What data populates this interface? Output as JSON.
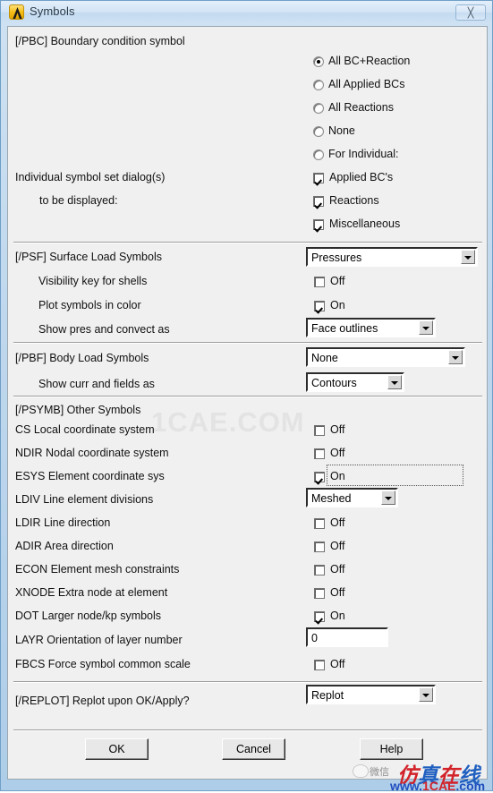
{
  "window": {
    "title": "Symbols",
    "icon": "ansys-logo-icon",
    "close_label": "╳"
  },
  "sections": {
    "pbc": {
      "heading": "[/PBC] Boundary condition symbol",
      "label_line1": "Individual symbol set dialog(s)",
      "label_line2": "to be displayed:",
      "radios": [
        {
          "label": "All BC+Reaction",
          "checked": true
        },
        {
          "label": "All Applied BCs",
          "checked": false
        },
        {
          "label": "All Reactions",
          "checked": false
        },
        {
          "label": "None",
          "checked": false
        },
        {
          "label": "For Individual:",
          "checked": false
        }
      ],
      "checkboxes": [
        {
          "label": "Applied BC's",
          "checked": true
        },
        {
          "label": "Reactions",
          "checked": true
        },
        {
          "label": "Miscellaneous",
          "checked": true
        }
      ]
    },
    "psf": {
      "heading": "[/PSF]  Surface Load Symbols",
      "heading_value": "Pressures",
      "rows": [
        {
          "label": "Visibility key for shells",
          "type": "checkbox",
          "state": "Off",
          "checked": false
        },
        {
          "label": "Plot symbols in color",
          "type": "checkbox",
          "state": "On",
          "checked": true
        },
        {
          "label": "Show pres and convect as",
          "type": "combo",
          "value": "Face outlines"
        }
      ]
    },
    "pbf": {
      "heading": "[/PBF]  Body Load Symbols",
      "heading_value": "None",
      "rows": [
        {
          "label": "Show curr and fields as",
          "type": "combo",
          "value": "Contours"
        }
      ]
    },
    "psymb": {
      "heading": "[/PSYMB] Other Symbols",
      "rows": [
        {
          "label": "CS   Local coordinate system",
          "type": "checkbox",
          "state": "Off",
          "checked": false,
          "focused": false
        },
        {
          "label": "NDIR Nodal coordinate system",
          "type": "checkbox",
          "state": "Off",
          "checked": false,
          "focused": false
        },
        {
          "label": "ESYS Element coordinate sys",
          "type": "checkbox",
          "state": "On",
          "checked": true,
          "focused": true
        },
        {
          "label": "LDIV  Line element divisions",
          "type": "combo",
          "value": "Meshed"
        },
        {
          "label": "LDIR Line direction",
          "type": "checkbox",
          "state": "Off",
          "checked": false,
          "focused": false
        },
        {
          "label": "ADIR Area direction",
          "type": "checkbox",
          "state": "Off",
          "checked": false,
          "focused": false
        },
        {
          "label": "ECON Element mesh constraints",
          "type": "checkbox",
          "state": "Off",
          "checked": false,
          "focused": false
        },
        {
          "label": "XNODE Extra node at element",
          "type": "checkbox",
          "state": "Off",
          "checked": false,
          "focused": false
        },
        {
          "label": "DOT  Larger node/kp symbols",
          "type": "checkbox",
          "state": "On",
          "checked": true,
          "focused": false
        },
        {
          "label": "LAYR Orientation of layer number",
          "type": "text",
          "value": "0"
        },
        {
          "label": "FBCS Force symbol common scale",
          "type": "checkbox",
          "state": "Off",
          "checked": false,
          "focused": false
        }
      ]
    },
    "replot": {
      "heading": "[/REPLOT] Replot upon OK/Apply?",
      "value": "Replot"
    }
  },
  "buttons": {
    "ok": "OK",
    "cancel": "Cancel",
    "help": "Help"
  },
  "watermarks": {
    "center": "1CAE.COM",
    "footer_wechat": "微信",
    "footer_brand_red1": "仿",
    "footer_brand_blue1": "真",
    "footer_brand_red2": "在",
    "footer_brand_blue2": "线",
    "footer_url_www": "www.",
    "footer_url_name": "1CAE",
    "footer_url_tld": ".com"
  },
  "colors": {
    "accent": "#1f5fbf",
    "brand_red": "#d2232a",
    "dialog_bg": "#f0f0f0",
    "frame": "#aecde8"
  }
}
